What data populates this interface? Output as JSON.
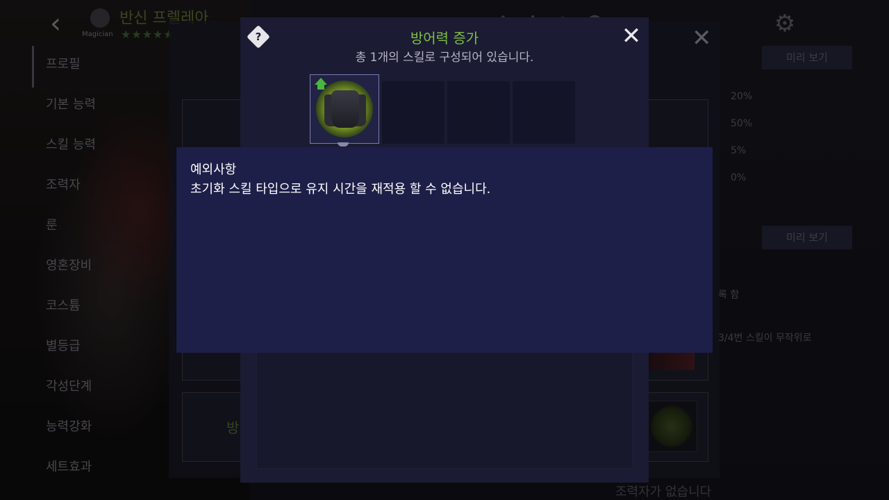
{
  "background": {
    "character_name": "반신 프렐레아",
    "character_role": "Magician",
    "stars": "★★★★★",
    "side_menu": [
      "프로필",
      "기본 능력",
      "스킬 능력",
      "조력자",
      "룬",
      "영혼장비",
      "코스튬",
      "별등급",
      "각성단계",
      "능력강화",
      "세트효과"
    ],
    "preview_label": "미리 보기",
    "stats": [
      "20%",
      "50%",
      "5%",
      "0%"
    ],
    "partial_text_1": "록 함",
    "partial_text_2": "3/4번 스킬이 무작위로",
    "partial_green": "방",
    "no_helper": "조력자가 없습니다"
  },
  "dialog": {
    "title": "방어력 증가",
    "subtitle": "총 1개의 스킬로 구성되어 있습니다.",
    "help_icon_label": "?",
    "close_label": "✕",
    "slots": 4
  },
  "tooltip": {
    "title": "예외사항",
    "body": "초기화 스킬 타입으로 유지 시간을 재적용 할 수 없습니다."
  },
  "colors": {
    "title_green": "#7fc042",
    "dialog_bg": "#1b1b33",
    "tooltip_bg": "#1e1f48"
  }
}
